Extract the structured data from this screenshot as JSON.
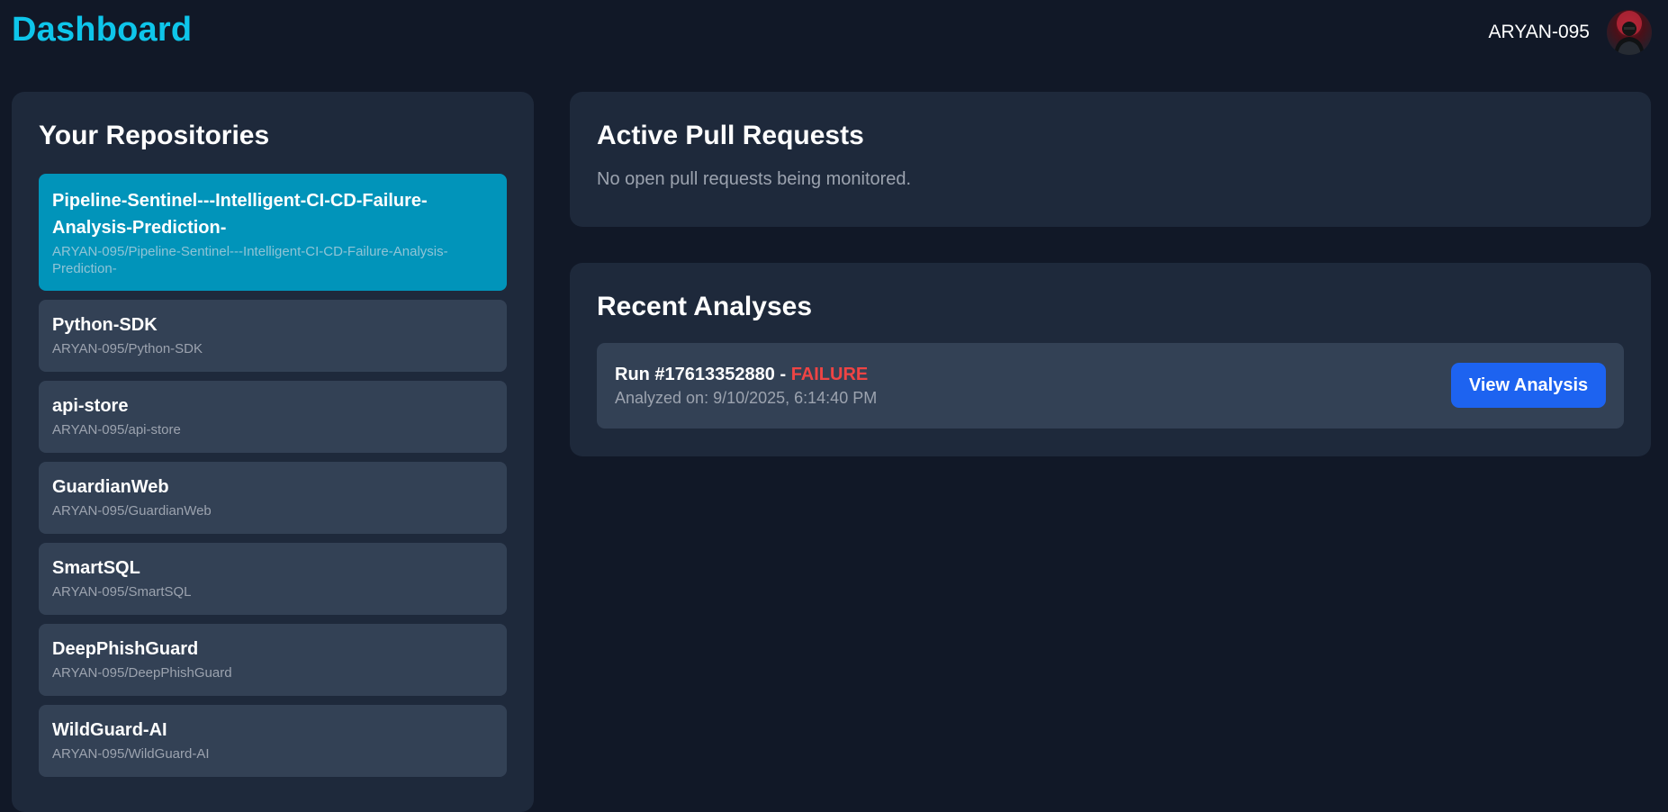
{
  "header": {
    "title": "Dashboard",
    "username": "ARYAN-095",
    "avatar_icon": "user-avatar-photo"
  },
  "repositories": {
    "title": "Your Repositories",
    "items": [
      {
        "name": "Pipeline-Sentinel---Intelligent-CI-CD-Failure-Analysis-Prediction-",
        "full_name": "ARYAN-095/Pipeline-Sentinel---Intelligent-CI-CD-Failure-Analysis-Prediction-",
        "selected": true
      },
      {
        "name": "Python-SDK",
        "full_name": "ARYAN-095/Python-SDK",
        "selected": false
      },
      {
        "name": "api-store",
        "full_name": "ARYAN-095/api-store",
        "selected": false
      },
      {
        "name": "GuardianWeb",
        "full_name": "ARYAN-095/GuardianWeb",
        "selected": false
      },
      {
        "name": "SmartSQL",
        "full_name": "ARYAN-095/SmartSQL",
        "selected": false
      },
      {
        "name": "DeepPhishGuard",
        "full_name": "ARYAN-095/DeepPhishGuard",
        "selected": false
      },
      {
        "name": "WildGuard-AI",
        "full_name": "ARYAN-095/WildGuard-AI",
        "selected": false
      }
    ]
  },
  "pull_requests": {
    "title": "Active Pull Requests",
    "empty_message": "No open pull requests being monitored."
  },
  "analyses": {
    "title": "Recent Analyses",
    "items": [
      {
        "run_label": "Run #17613352880 - ",
        "status": "FAILURE",
        "analyzed_on": "Analyzed on: 9/10/2025, 6:14:40 PM",
        "button_label": "View Analysis"
      }
    ]
  },
  "colors": {
    "background": "#111827",
    "panel": "#1e293b",
    "card": "#334155",
    "accent": "#0ec5ea",
    "selected": "#0194ba",
    "failure": "#ef4444",
    "button": "#1d63f0"
  }
}
